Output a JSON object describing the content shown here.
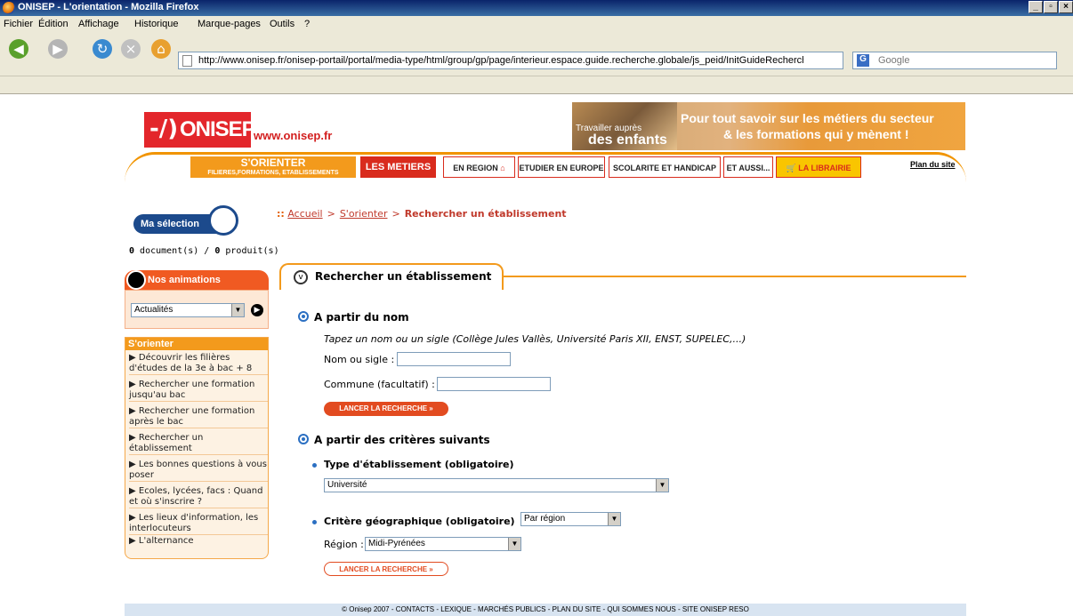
{
  "browser": {
    "title": "ONISEP - L'orientation - Mozilla Firefox",
    "menu": [
      "Fichier",
      "Édition",
      "Affichage",
      "Historique",
      "Marque-pages",
      "Outils",
      "?"
    ],
    "url": "http://www.onisep.fr/onisep-portail/portal/media-type/html/group/gp/page/interieur.espace.guide.recherche.globale/js_peid/InitGuideRechercheGlol",
    "search_placeholder": "Google"
  },
  "header": {
    "logo": "ONISEP",
    "site": "www.onisep.fr",
    "banner_small": "Travailler auprès",
    "banner_big": "des enfants",
    "banner_line1": "Pour tout savoir sur les métiers du secteur",
    "banner_line2": "& les formations qui y mènent !"
  },
  "nav": {
    "orienter_big": "S'ORIENTER",
    "orienter_small": "FILIERES,FORMATIONS, ETABLISSEMENTS",
    "metiers": "LES METIERS",
    "region": "EN REGION",
    "europe": "ETUDIER EN EUROPE",
    "scolarite": "SCOLARITE ET HANDICAP",
    "aussi": "ET AUSSI...",
    "librairie": "LA LIBRAIRIE",
    "plan": "Plan du site"
  },
  "sidebar": {
    "ma_selection": "Ma sélection",
    "docs_count": "0",
    "docs_label": " document(s) / ",
    "prod_count": "0",
    "prod_label": " produit(s)",
    "animations_title": "Nos animations",
    "animations_selected": "Actualités",
    "orienter_title": "S'orienter",
    "items": [
      "▶ Découvrir les filières d'études de la 3e à bac + 8",
      "▶ Rechercher une formation jusqu'au bac",
      "▶ Rechercher une formation après le bac",
      "▶ Rechercher un établissement",
      "▶ Les bonnes questions à vous poser",
      "▶ Ecoles, lycées, facs : Quand et où s'inscrire ?",
      "▶ Les lieux d'information, les interlocuteurs",
      "▶ L'alternance"
    ]
  },
  "breadcrumb": {
    "home": "Accueil",
    "parent": "S'orienter",
    "current": "Rechercher un établissement"
  },
  "panel": {
    "title": "Rechercher un établissement",
    "by_name": "A partir du nom",
    "hint": "Tapez un nom ou un sigle (Collège Jules Vallès, Université Paris XII, ENST, SUPELEC,...)",
    "name_label": "Nom ou sigle :",
    "commune_label": "Commune (facultatif) :",
    "search_btn": "LANCER LA RECHERCHE »",
    "by_criteria": "A partir des critères suivants",
    "type_label": "Type d'établissement (obligatoire)",
    "type_value": "Université",
    "geo_label": "Critère géographique (obligatoire)",
    "geo_value": "Par région",
    "region_label": "Région :",
    "region_value": "Midi-Pyrénées",
    "search_btn2": "LANCER LA RECHERCHE »"
  },
  "footer": "© Onisep 2007 - CONTACTS - LEXIQUE - MARCHÉS PUBLICS - PLAN DU SITE - QUI SOMMES NOUS - SITE ONISEP RESO"
}
